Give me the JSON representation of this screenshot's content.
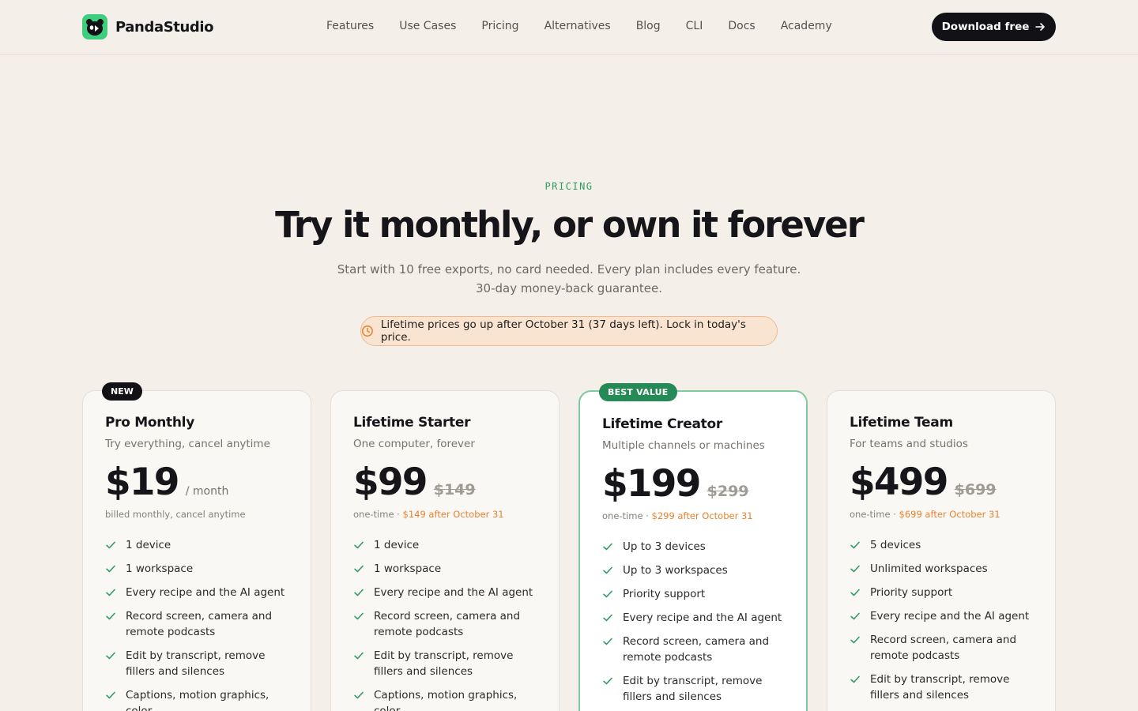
{
  "nav": {
    "brand": "PandaStudio",
    "links": [
      "Features",
      "Use Cases",
      "Pricing",
      "Alternatives",
      "Blog",
      "CLI",
      "Docs",
      "Academy"
    ],
    "cta": "Download free"
  },
  "hero": {
    "eyebrow": "PRICING",
    "title": "Try it monthly, or own it forever",
    "subtitle_line1": "Start with 10 free exports, no card needed. Every plan includes every feature.",
    "subtitle_line2": "30-day money-back guarantee.",
    "notice": "Lifetime prices go up after October 31 (37 days left). Lock in today's price."
  },
  "colors": {
    "accent_green": "#2e9b62",
    "warning_orange": "#e8822e",
    "dark": "#121216"
  },
  "plans": [
    {
      "badge": "NEW",
      "name": "Pro Monthly",
      "desc": "Try everything, cancel anytime",
      "price": "$19",
      "period": "/ month",
      "billing": "billed monthly, cancel anytime",
      "features": [
        "1 device",
        "1 workspace",
        "Every recipe and the AI agent",
        "Record screen, camera and remote podcasts",
        "Edit by transcript, remove fillers and silences",
        "Captions, motion graphics, color"
      ]
    },
    {
      "name": "Lifetime Starter",
      "desc": "One computer, forever",
      "price": "$99",
      "old_price": "$149",
      "billing_prefix": "one-time · ",
      "billing_warn": "$149 after October 31",
      "features": [
        "1 device",
        "1 workspace",
        "Every recipe and the AI agent",
        "Record screen, camera and remote podcasts",
        "Edit by transcript, remove fillers and silences",
        "Captions, motion graphics, color"
      ]
    },
    {
      "badge": "BEST VALUE",
      "name": "Lifetime Creator",
      "desc": "Multiple channels or machines",
      "price": "$199",
      "old_price": "$299",
      "billing_prefix": "one-time · ",
      "billing_warn": "$299 after October 31",
      "features": [
        "Up to 3 devices",
        "Up to 3 workspaces",
        "Priority support",
        "Every recipe and the AI agent",
        "Record screen, camera and remote podcasts",
        "Edit by transcript, remove fillers and silences"
      ]
    },
    {
      "name": "Lifetime Team",
      "desc": "For teams and studios",
      "price": "$499",
      "old_price": "$699",
      "billing_prefix": "one-time · ",
      "billing_warn": "$699 after October 31",
      "features": [
        "5 devices",
        "Unlimited workspaces",
        "Priority support",
        "Every recipe and the AI agent",
        "Record screen, camera and remote podcasts",
        "Edit by transcript, remove fillers and silences"
      ]
    }
  ]
}
